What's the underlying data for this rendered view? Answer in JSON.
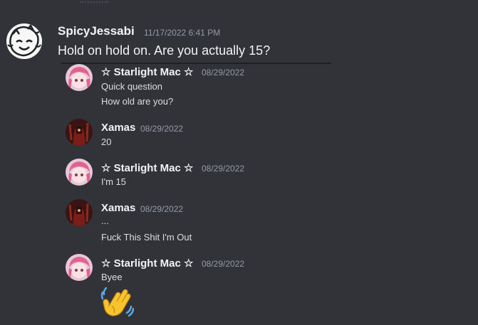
{
  "main_message": {
    "author": "SpicyJessabi",
    "timestamp": "11/17/2022 6:41 PM",
    "text": "Hold on hold on. Are you actually 15?"
  },
  "quoted": [
    {
      "author": "☆ Starlight Mac ☆",
      "date": "08/29/2022",
      "lines": [
        "Quick question",
        "How old are you?"
      ]
    },
    {
      "author": "Xamas",
      "date": "08/29/2022",
      "lines": [
        "20"
      ]
    },
    {
      "author": "☆ Starlight Mac ☆",
      "date": "08/29/2022",
      "lines": [
        "I'm 15"
      ]
    },
    {
      "author": "Xamas",
      "date": "08/29/2022",
      "lines": [
        "...",
        "Fuck This Shit I'm Out"
      ]
    },
    {
      "author": "☆ Starlight Mac ☆",
      "date": "08/29/2022",
      "lines": [
        "Byee"
      ],
      "emoji": "waving-hand"
    }
  ],
  "colors": {
    "background": "#313338",
    "username": "#f2f3f5",
    "timestamp": "#949ba4",
    "text": "#dbdee1"
  }
}
